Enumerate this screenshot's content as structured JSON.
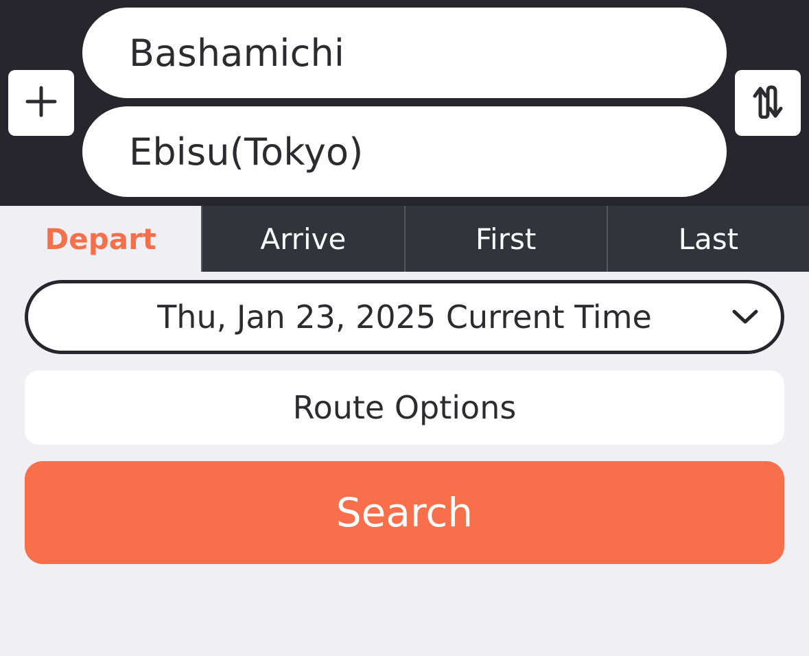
{
  "route": {
    "from_station": "Bashamichi",
    "to_station": "Ebisu(Tokyo)",
    "add_icon": "plus-icon",
    "swap_icon": "swap-vertical-icon"
  },
  "tabs": [
    {
      "label": "Depart",
      "active": true
    },
    {
      "label": "Arrive",
      "active": false
    },
    {
      "label": "First",
      "active": false
    },
    {
      "label": "Last",
      "active": false
    }
  ],
  "datetime": {
    "value": "Thu, Jan 23, 2025 Current Time",
    "icon": "chevron-down-icon"
  },
  "route_options": {
    "label": "Route Options"
  },
  "search": {
    "label": "Search"
  },
  "colors": {
    "accent": "#f7704b",
    "header_bg": "#26262c",
    "tab_bg": "#33333b",
    "page_bg": "#efeff4"
  }
}
